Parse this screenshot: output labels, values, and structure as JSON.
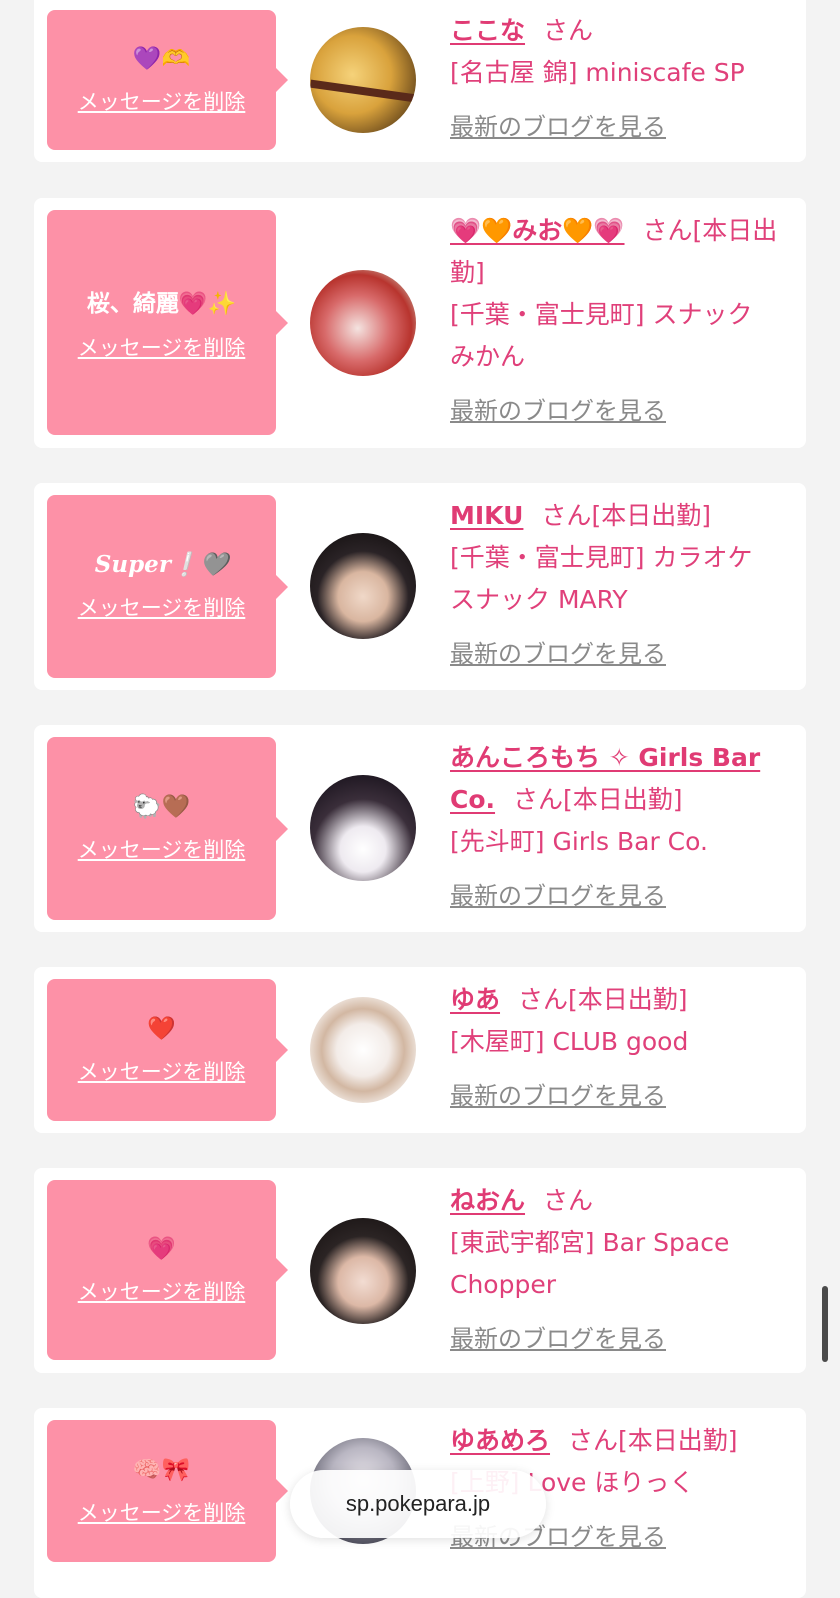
{
  "delete_label": "メッセージを削除",
  "san_label": "さん",
  "blog_link_label": "最新のブログを見る",
  "url_bar": "sp.pokepara.jp",
  "cards": [
    {
      "message": "💜🫶",
      "name": "ここな",
      "status": "",
      "shop": "[名古屋 錦] miniscafe SP"
    },
    {
      "message": "桜、綺麗💗✨",
      "name": "💗🧡みお🧡💗",
      "status": "[本日出勤]",
      "shop": "[千葉・富士見町] スナック みかん"
    },
    {
      "message": "Super❕🩶",
      "name": "MIKU",
      "status": "[本日出勤]",
      "shop": "[千葉・富士見町] カラオケ スナック MARY"
    },
    {
      "message": "🐑🤎",
      "name": "あんころもち ✧ Girls Bar Co.",
      "status": "[本日出勤]",
      "shop": "[先斗町] Girls Bar Co."
    },
    {
      "message": "❤️",
      "name": "ゆあ",
      "status": "[本日出勤]",
      "shop": "[木屋町] CLUB good"
    },
    {
      "message": "💗",
      "name": "ねおん",
      "status": "",
      "shop": "[東武宇都宮] Bar Space Chopper"
    },
    {
      "message": "🧠🎀",
      "name": "ゆあめろ",
      "status": "[本日出勤]",
      "shop": "[上野] Love ほりっく"
    }
  ],
  "colors": {
    "bubble": "#fd91a7",
    "name": "#e03b74",
    "shop": "#e0407a",
    "link": "#8a8a8a"
  }
}
